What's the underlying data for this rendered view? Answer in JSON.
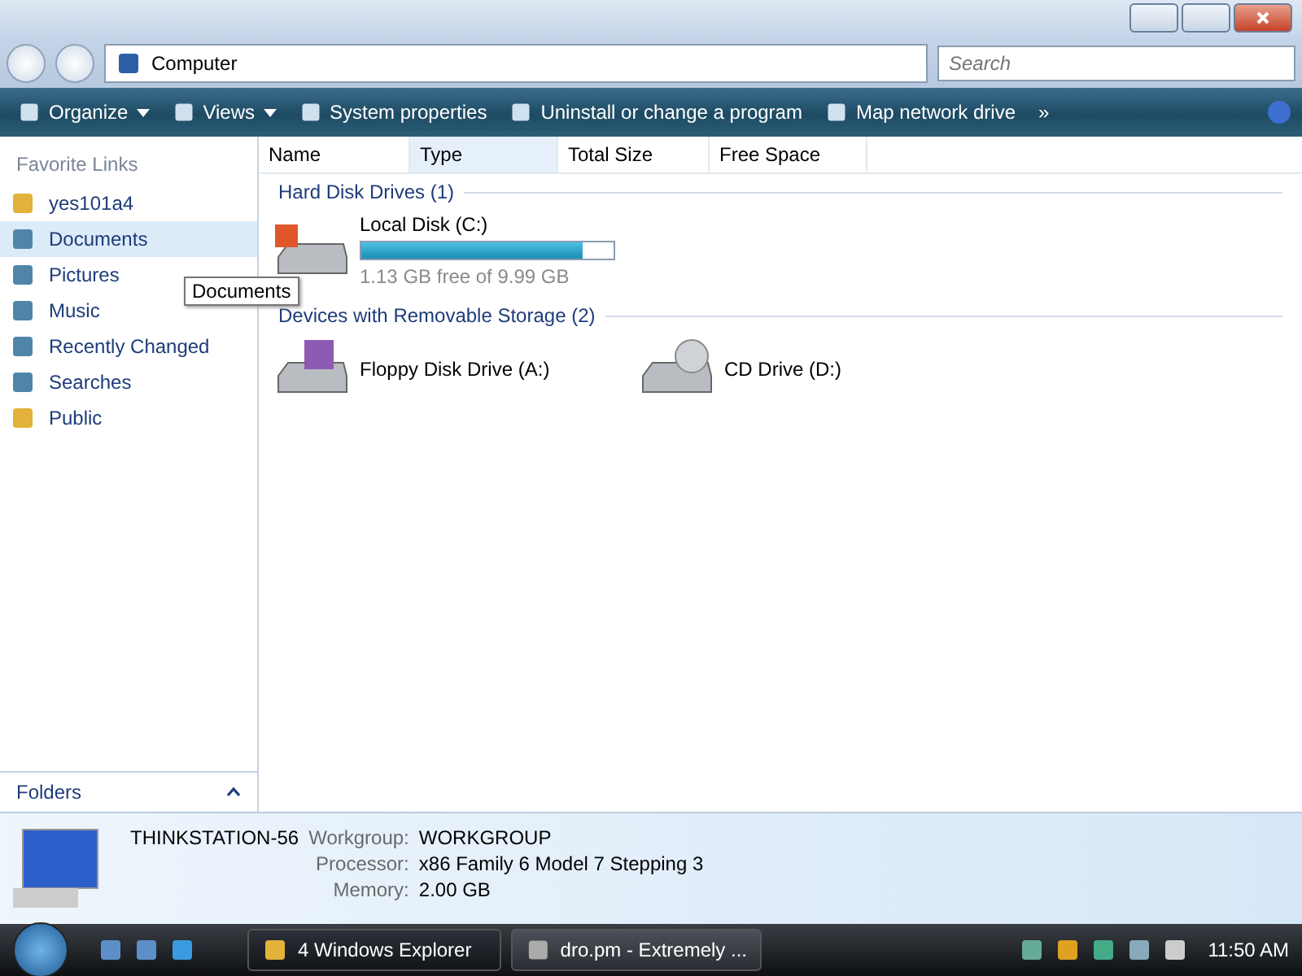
{
  "address_bar": {
    "crumbs": [
      "Computer"
    ]
  },
  "search": {
    "placeholder": "Search"
  },
  "toolbar": [
    {
      "label": "Organize",
      "kind": "menu"
    },
    {
      "label": "Views",
      "kind": "menu"
    },
    {
      "label": "System properties",
      "kind": "button"
    },
    {
      "label": "Uninstall or change a program",
      "kind": "button"
    },
    {
      "label": "Map network drive",
      "kind": "button"
    },
    {
      "label": "»",
      "kind": "more"
    }
  ],
  "sidebar": {
    "title": "Favorite Links",
    "items": [
      {
        "label": "yes101a4",
        "selected": false
      },
      {
        "label": "Documents",
        "selected": true
      },
      {
        "label": "Pictures",
        "selected": false
      },
      {
        "label": "Music",
        "selected": false
      },
      {
        "label": "Recently Changed",
        "selected": false
      },
      {
        "label": "Searches",
        "selected": false
      },
      {
        "label": "Public",
        "selected": false
      }
    ],
    "folders": "Folders"
  },
  "tooltip": "Documents",
  "columns": [
    {
      "label": "Name",
      "sorted": false
    },
    {
      "label": "Type",
      "sorted": true
    },
    {
      "label": "Total Size",
      "sorted": false
    },
    {
      "label": "Free Space",
      "sorted": false
    }
  ],
  "groups": [
    {
      "title": "Hard Disk Drives (1)",
      "items": [
        {
          "kind": "disk",
          "name": "Local Disk (C:)",
          "level": 0.88,
          "free": "1.13 GB free of 9.99 GB"
        }
      ]
    },
    {
      "title": "Devices with Removable Storage (2)",
      "items": [
        {
          "kind": "floppy",
          "name": "Floppy Disk Drive (A:)"
        },
        {
          "kind": "cd",
          "name": "CD Drive (D:)"
        }
      ]
    }
  ],
  "details": {
    "name": "THINKSTATION-56",
    "rows": [
      {
        "label": "Workgroup:",
        "value": "WORKGROUP"
      },
      {
        "label": "Processor:",
        "value": "x86 Family 6 Model 7 Stepping 3"
      },
      {
        "label": "Memory:",
        "value": "2.00 GB"
      }
    ]
  },
  "taskbar": {
    "tasks": [
      {
        "label": "4 Windows Explorer",
        "selected": true
      },
      {
        "label": "dro.pm - Extremely ...",
        "selected": false
      }
    ],
    "clock": "11:50 AM"
  }
}
